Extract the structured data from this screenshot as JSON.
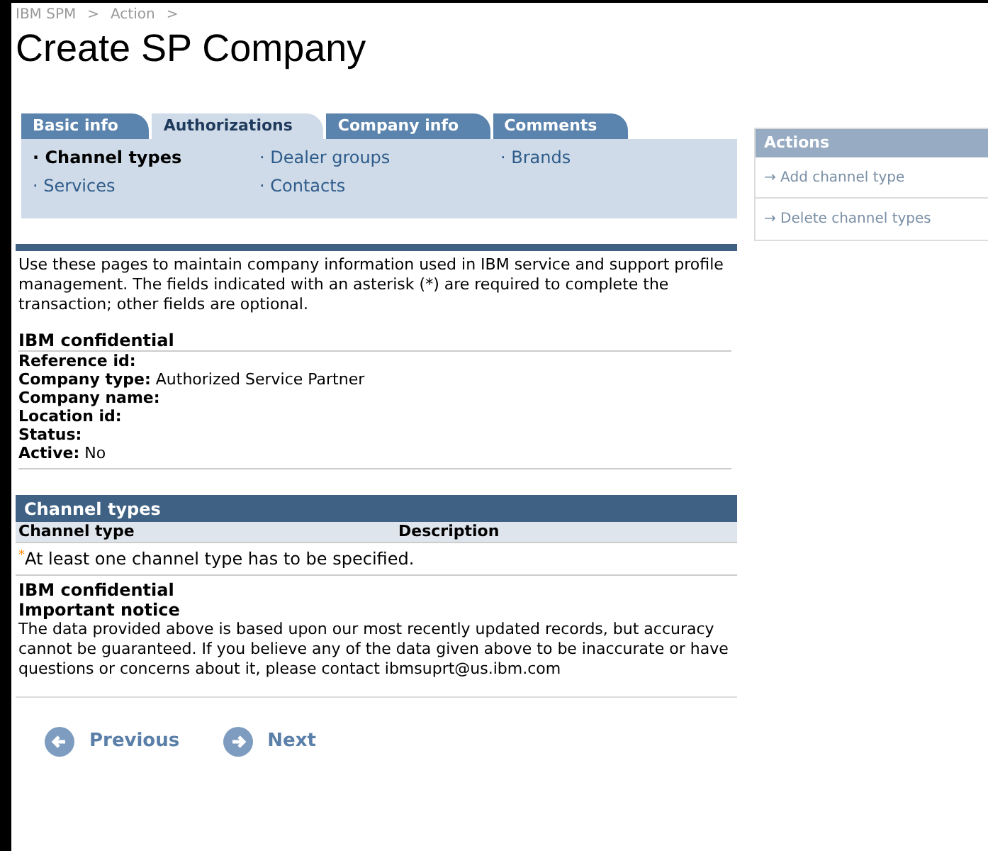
{
  "breadcrumb": [
    {
      "label": "IBM SPM",
      "separator": ">"
    },
    {
      "label": "Action",
      "separator": ">"
    }
  ],
  "title": "Create SP Company",
  "tabs": [
    {
      "label": "Basic info",
      "selected": false
    },
    {
      "label": "Authorizations",
      "selected": true
    },
    {
      "label": "Company info",
      "selected": false
    },
    {
      "label": "Comments",
      "selected": false
    }
  ],
  "subnav": [
    {
      "label": "· Channel types",
      "selected": true
    },
    {
      "label": "· Dealer groups",
      "selected": false
    },
    {
      "label": "· Brands",
      "selected": false
    },
    {
      "label": "· Services",
      "selected": false
    },
    {
      "label": "· Contacts",
      "selected": false
    }
  ],
  "actions": {
    "title": "Actions",
    "items": [
      "→ Add channel type",
      "→ Delete channel types"
    ]
  },
  "intro": "Use these pages to maintain company information used in IBM service and support profile management. The fields indicated with an asterisk (*) are required to complete the transaction; other fields are optional.",
  "info": {
    "heading": "IBM confidential",
    "fields": [
      {
        "label": "Reference id:"
      },
      {
        "label": "Company type:",
        "value": "Authorized Service Partner"
      },
      {
        "label": "Company name:"
      },
      {
        "label": "Location id:"
      },
      {
        "label": "Status:"
      },
      {
        "label": "Active:",
        "value": "No"
      }
    ]
  },
  "channel_types": {
    "title": "Channel types",
    "columns": [
      "Channel type",
      "Description"
    ],
    "note": "$^{*}$At least one channel type has to be specified."
  },
  "notice": {
    "confidential": "IBM confidential",
    "heading": "Important notice",
    "text": "The data provided above is based upon our most recently updated records, but accuracy cannot be guaranteed. If you believe any of the data given above to be inaccurate or have questions or concerns about it, please contact ibmsuprt@us.ibm.com"
  },
  "buttons": [
    {
      "label": "Previous",
      "kind": "back"
    },
    {
      "label": "Next",
      "kind": "forward"
    }
  ]
}
